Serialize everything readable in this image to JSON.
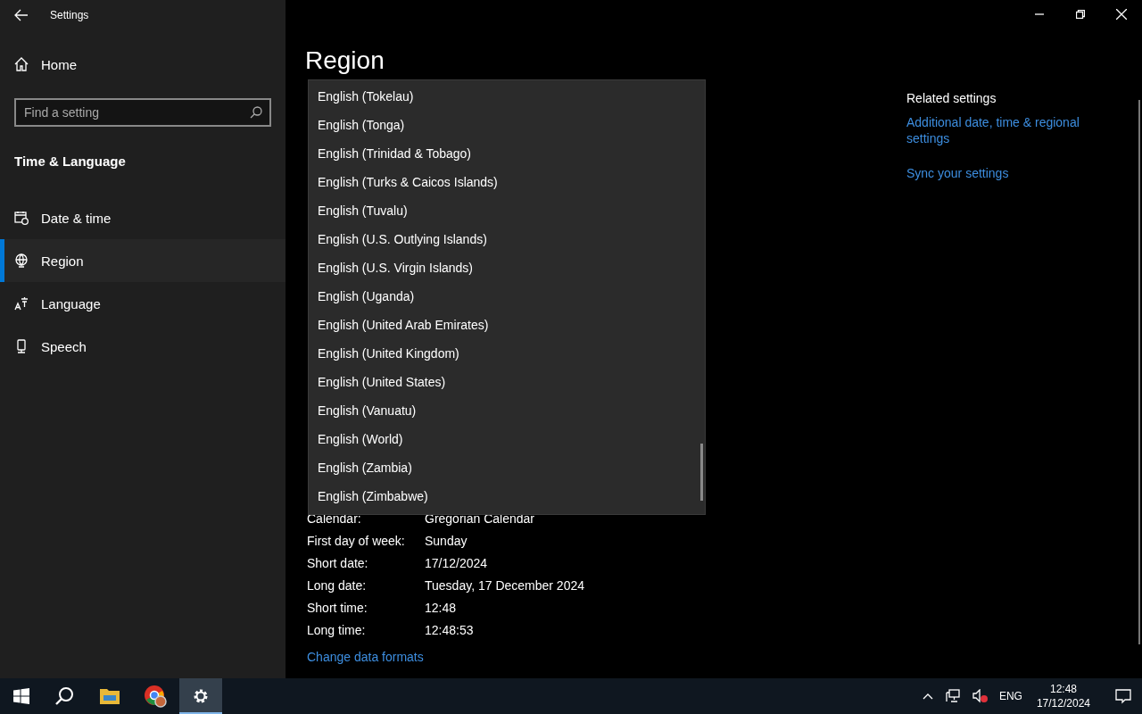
{
  "window": {
    "title": "Settings"
  },
  "sidebar": {
    "home": "Home",
    "search": {
      "placeholder": "Find a setting"
    },
    "section": "Time & Language",
    "items": [
      {
        "label": "Date & time",
        "selected": false
      },
      {
        "label": "Region",
        "selected": true
      },
      {
        "label": "Language",
        "selected": false
      },
      {
        "label": "Speech",
        "selected": false
      }
    ]
  },
  "main": {
    "title": "Region",
    "dropdown": {
      "options": [
        "English (Tokelau)",
        "English (Tonga)",
        "English (Trinidad & Tobago)",
        "English (Turks & Caicos Islands)",
        "English (Tuvalu)",
        "English (U.S. Outlying Islands)",
        "English (U.S. Virgin Islands)",
        "English (Uganda)",
        "English (United Arab Emirates)",
        "English (United Kingdom)",
        "English (United States)",
        "English (Vanuatu)",
        "English (World)",
        "English (Zambia)",
        "English (Zimbabwe)"
      ]
    },
    "formats": [
      {
        "label": "Calendar:",
        "value": "Gregorian Calendar"
      },
      {
        "label": "First day of week:",
        "value": "Sunday"
      },
      {
        "label": "Short date:",
        "value": "17/12/2024"
      },
      {
        "label": "Long date:",
        "value": "Tuesday, 17 December 2024"
      },
      {
        "label": "Short time:",
        "value": "12:48"
      },
      {
        "label": "Long time:",
        "value": "12:48:53"
      }
    ],
    "link": "Change data formats"
  },
  "related": {
    "heading": "Related settings",
    "links": [
      "Additional date, time & regional settings",
      "Sync your settings"
    ]
  },
  "taskbar": {
    "apps": [
      {
        "selected": false
      },
      {
        "selected": false
      },
      {
        "selected": true
      }
    ],
    "tray": {
      "language": "ENG",
      "time": "12:48",
      "date": "17/12/2024"
    }
  }
}
